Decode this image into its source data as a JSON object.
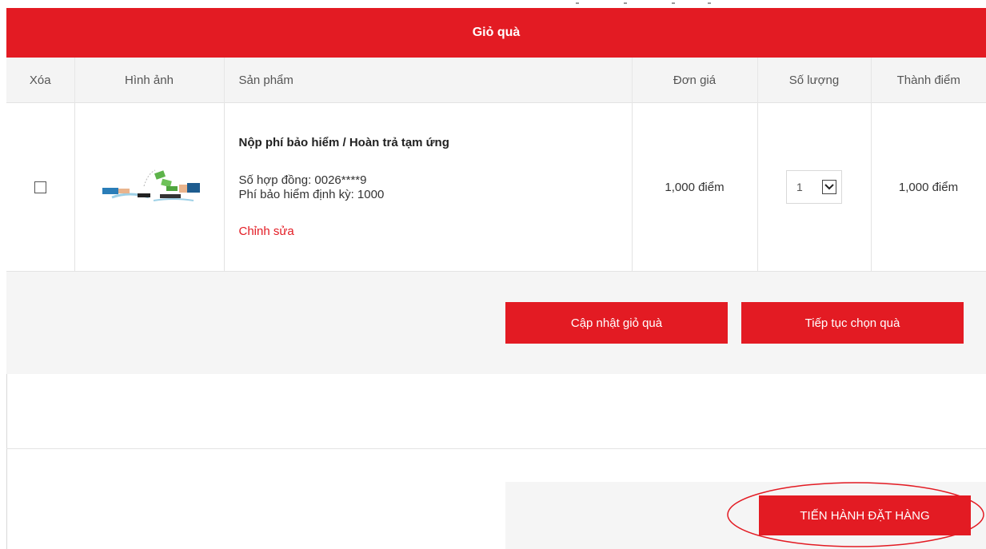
{
  "cart": {
    "title": "Giỏ quà",
    "columns": [
      "Xóa",
      "Hình ảnh",
      "Sản phẩm",
      "Đơn giá",
      "Số lượng",
      "Thành điểm"
    ],
    "items": [
      {
        "name": "Nộp phí bảo hiểm / Hoàn trả tạm ứng",
        "contract": "Số hợp đồng: 0026****9",
        "periodic_fee": "Phí bảo hiểm định kỳ: 1000",
        "edit_label": "Chỉnh sửa",
        "unit_price": "1,000 điểm",
        "quantity": "1",
        "total": "1,000 điểm",
        "image_icon": "payment-hands-icon"
      }
    ]
  },
  "actions": {
    "update_label": "Cập nhật giỏ quà",
    "continue_label": "Tiếp tục chọn quà",
    "checkout_label": "TIẾN HÀNH ĐẶT HÀNG"
  },
  "colors": {
    "brand_red": "#e31b23",
    "header_gray": "#f4f4f4",
    "panel_gray": "#f5f5f5"
  }
}
